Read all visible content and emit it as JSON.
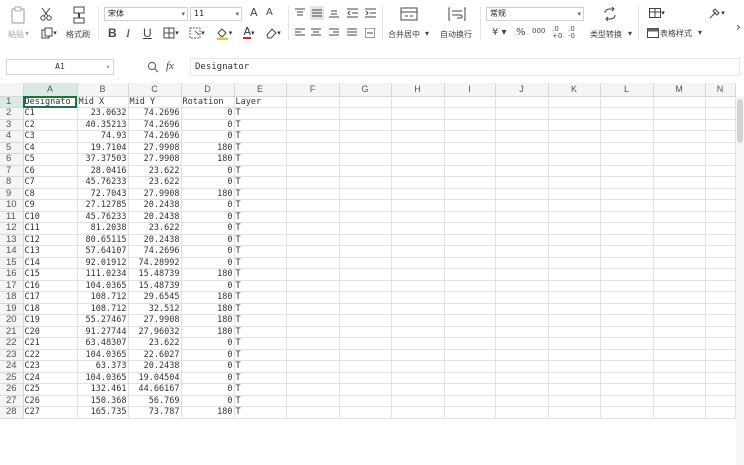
{
  "ribbon": {
    "paste_label": "粘贴",
    "format_painter_label": "格式刷",
    "font_name": "宋体",
    "font_size": "11",
    "merge_center_label": "合并居中",
    "wrap_text_label": "自动换行",
    "number_format": "常规",
    "type_convert_label": "类型转换",
    "table_style_label": "表格样式",
    "currency_symbol": "¥",
    "percent_symbol": "%",
    "thousands_symbol": "000",
    "bold": "B",
    "italic": "I",
    "underline": "U",
    "font_grow": "A",
    "font_shrink": "A",
    "font_color": "A",
    "more_arrow": "›"
  },
  "formula_bar": {
    "cell_ref": "A1",
    "fx_label": "fx",
    "content": "Designator"
  },
  "sheet": {
    "columns": [
      "A",
      "B",
      "C",
      "D",
      "E",
      "F",
      "G",
      "H",
      "I",
      "J",
      "K",
      "L",
      "M",
      "N"
    ],
    "rows": [
      {
        "n": "1",
        "cells": [
          "Designato",
          "Mid X",
          "Mid Y",
          "Rotation",
          "Layer"
        ]
      },
      {
        "n": "2",
        "cells": [
          "C1",
          "23.0632",
          "74.2696",
          "0",
          "T"
        ]
      },
      {
        "n": "3",
        "cells": [
          "C2",
          "40.35213",
          "74.2696",
          "0",
          "T"
        ]
      },
      {
        "n": "4",
        "cells": [
          "C3",
          "74.93",
          "74.2696",
          "0",
          "T"
        ]
      },
      {
        "n": "5",
        "cells": [
          "C4",
          "19.7104",
          "27.9908",
          "180",
          "T"
        ]
      },
      {
        "n": "6",
        "cells": [
          "C5",
          "37.37503",
          "27.9908",
          "180",
          "T"
        ]
      },
      {
        "n": "7",
        "cells": [
          "C6",
          "28.0416",
          "23.622",
          "0",
          "T"
        ]
      },
      {
        "n": "8",
        "cells": [
          "C7",
          "45.76233",
          "23.622",
          "0",
          "T"
        ]
      },
      {
        "n": "9",
        "cells": [
          "C8",
          "72.7043",
          "27.9908",
          "180",
          "T"
        ]
      },
      {
        "n": "10",
        "cells": [
          "C9",
          "27.12785",
          "20.2438",
          "0",
          "T"
        ]
      },
      {
        "n": "11",
        "cells": [
          "C10",
          "45.76233",
          "20.2438",
          "0",
          "T"
        ]
      },
      {
        "n": "12",
        "cells": [
          "C11",
          "81.2038",
          "23.622",
          "0",
          "T"
        ]
      },
      {
        "n": "13",
        "cells": [
          "C12",
          "80.65115",
          "20.2438",
          "0",
          "T"
        ]
      },
      {
        "n": "14",
        "cells": [
          "C13",
          "57.64107",
          "74.2696",
          "0",
          "T"
        ]
      },
      {
        "n": "15",
        "cells": [
          "C14",
          "92.01912",
          "74.28992",
          "0",
          "T"
        ]
      },
      {
        "n": "16",
        "cells": [
          "C15",
          "111.0234",
          "15.48739",
          "180",
          "T"
        ]
      },
      {
        "n": "17",
        "cells": [
          "C16",
          "104.0365",
          "15.48739",
          "0",
          "T"
        ]
      },
      {
        "n": "18",
        "cells": [
          "C17",
          "108.712",
          "29.6545",
          "180",
          "T"
        ]
      },
      {
        "n": "19",
        "cells": [
          "C18",
          "108.712",
          "32.512",
          "180",
          "T"
        ]
      },
      {
        "n": "20",
        "cells": [
          "C19",
          "55.27467",
          "27.9908",
          "180",
          "T"
        ]
      },
      {
        "n": "21",
        "cells": [
          "C20",
          "91.27744",
          "27.96032",
          "180",
          "T"
        ]
      },
      {
        "n": "22",
        "cells": [
          "C21",
          "63.48307",
          "23.622",
          "0",
          "T"
        ]
      },
      {
        "n": "23",
        "cells": [
          "C22",
          "104.0365",
          "22.6027",
          "0",
          "T"
        ]
      },
      {
        "n": "24",
        "cells": [
          "C23",
          "63.373",
          "20.2438",
          "0",
          "T"
        ]
      },
      {
        "n": "25",
        "cells": [
          "C24",
          "104.0365",
          "19.04504",
          "0",
          "T"
        ]
      },
      {
        "n": "26",
        "cells": [
          "C25",
          "132.461",
          "44.66167",
          "0",
          "T"
        ]
      },
      {
        "n": "27",
        "cells": [
          "C26",
          "150.368",
          "56.769",
          "0",
          "T"
        ]
      },
      {
        "n": "28",
        "cells": [
          "C27",
          "165.735",
          "73.787",
          "180",
          "T"
        ]
      }
    ]
  },
  "colors": {
    "accent": "#217346",
    "selection": "#1e7145",
    "header_bg": "#f5f5f5",
    "grid_line": "#e1e1e1"
  }
}
